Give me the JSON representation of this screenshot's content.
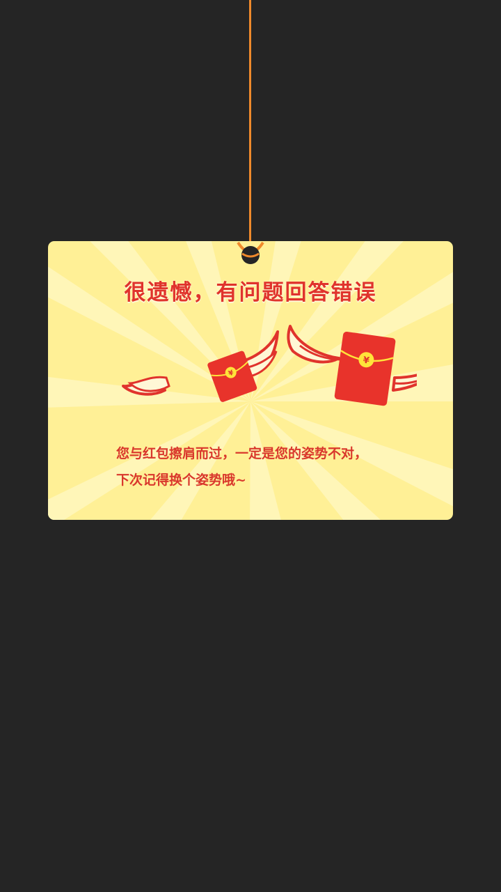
{
  "dialog": {
    "title": "很遗憾，有问题回答错误",
    "message_line1": "您与红包擦肩而过，一定是您的姿势不对，",
    "message_line2": "下次记得换个姿势哦~"
  },
  "illustration": {
    "coin_symbol": "¥",
    "icons": [
      "winged-red-envelope-icon",
      "winged-red-envelope-icon"
    ]
  },
  "colors": {
    "background": "#252525",
    "card": "#fff096",
    "card_rays": "#fff6b8",
    "string": "#f08a2c",
    "text_red": "#e0332c",
    "envelope_red": "#e8332b",
    "coin_yellow": "#ffe43a"
  }
}
